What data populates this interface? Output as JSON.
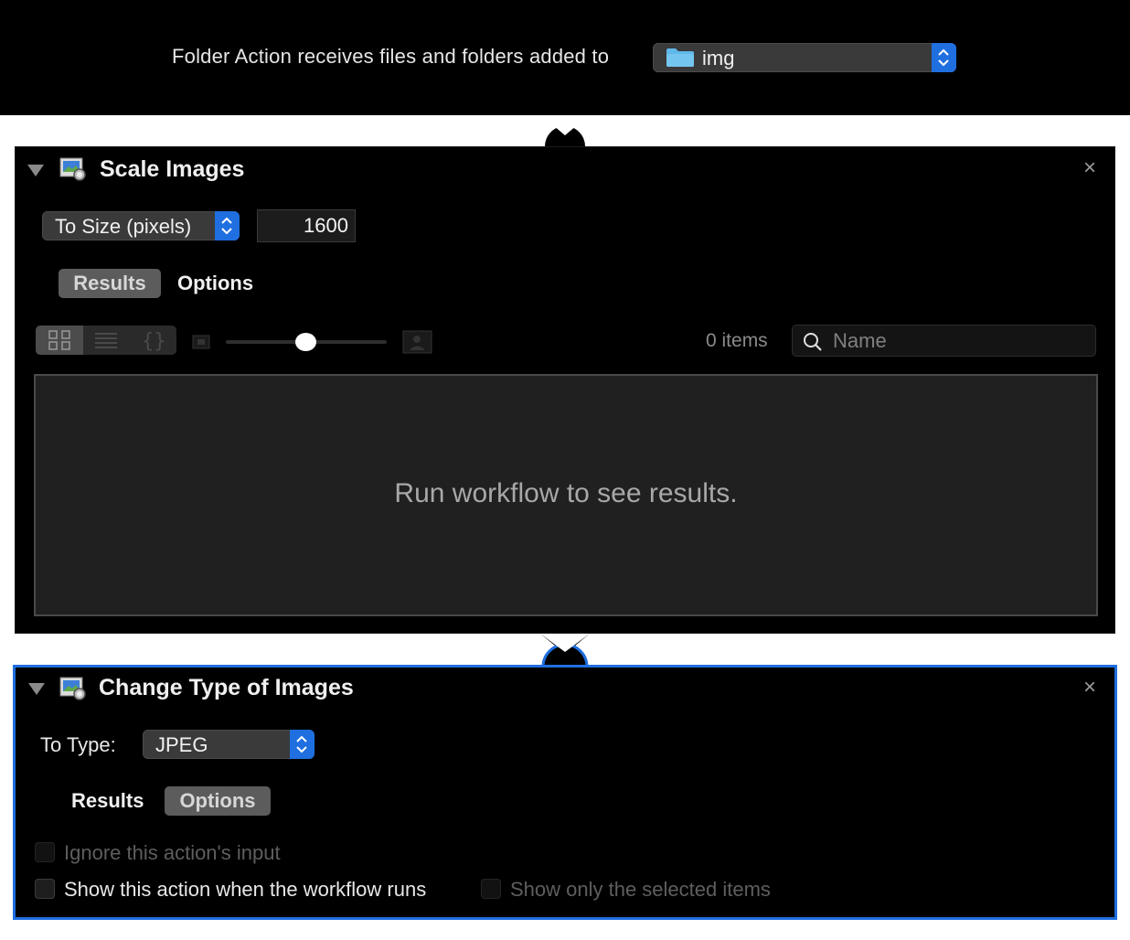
{
  "header": {
    "label": "Folder Action receives files and folders added to",
    "folder": "img"
  },
  "scale_images": {
    "title": "Scale Images",
    "mode": "To Size (pixels)",
    "size_value": "1600",
    "tab_results": "Results",
    "tab_options": "Options",
    "items_count": "0 items",
    "search_placeholder": "Name",
    "results_message": "Run workflow to see results.",
    "close_label": "×"
  },
  "change_type": {
    "title": "Change Type of Images",
    "to_type_label": "To Type:",
    "type_value": "JPEG",
    "tab_results": "Results",
    "tab_options": "Options",
    "ignore_input_label": "Ignore this action's input",
    "show_action_label": "Show this action when the workflow runs",
    "show_selected_label": "Show only the selected items",
    "close_label": "×"
  },
  "colors": {
    "accent": "#1f6fe0",
    "panel_bg": "#000000",
    "results_bg": "#202020"
  }
}
